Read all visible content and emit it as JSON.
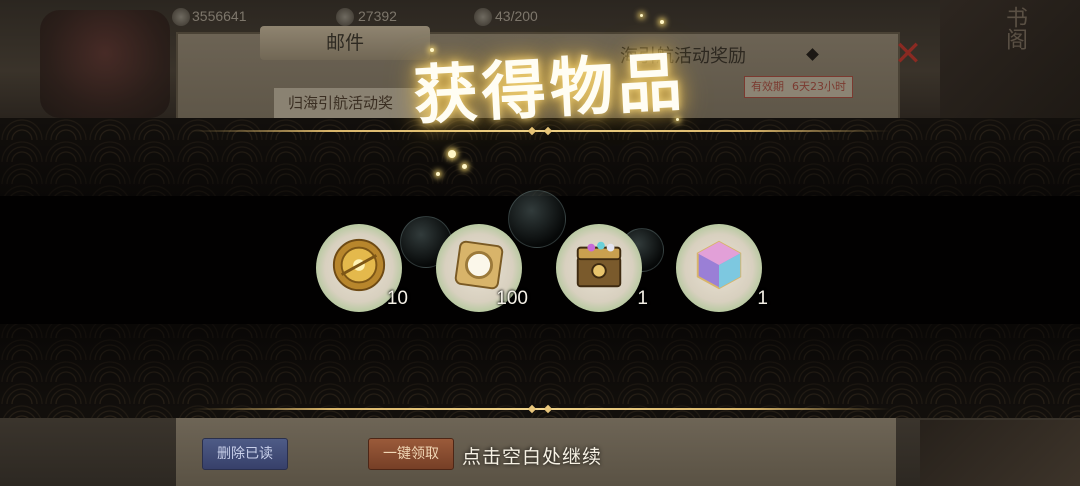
{
  "resources": [
    {
      "icon": "coin-icon",
      "value": "3556641"
    },
    {
      "icon": "jade-icon",
      "value": "27392"
    },
    {
      "icon": "stamina-icon",
      "value": "43/200"
    }
  ],
  "mail": {
    "tab_label": "邮件",
    "item_title": "归海引航活动奖",
    "detail_title": "海引航活动奖励",
    "validity_label": "有效期",
    "validity_value": "6天23小时",
    "delete_read_label": "删除已读",
    "claim_all_label": "一键领取"
  },
  "side_deco_text": "书阁",
  "reward_popup": {
    "title": "获得物品",
    "items": [
      {
        "name": "gold-medallion-icon",
        "count": "10"
      },
      {
        "name": "jade-ring-token-icon",
        "count": "100"
      },
      {
        "name": "treasure-chest-icon",
        "count": "1"
      },
      {
        "name": "crystal-cube-icon",
        "count": "1"
      }
    ],
    "continue_hint": "点击空白处继续"
  },
  "colors": {
    "gold": "#e8c67c",
    "title_glow": "#f2d37a",
    "overlay_dark": "#020101"
  }
}
